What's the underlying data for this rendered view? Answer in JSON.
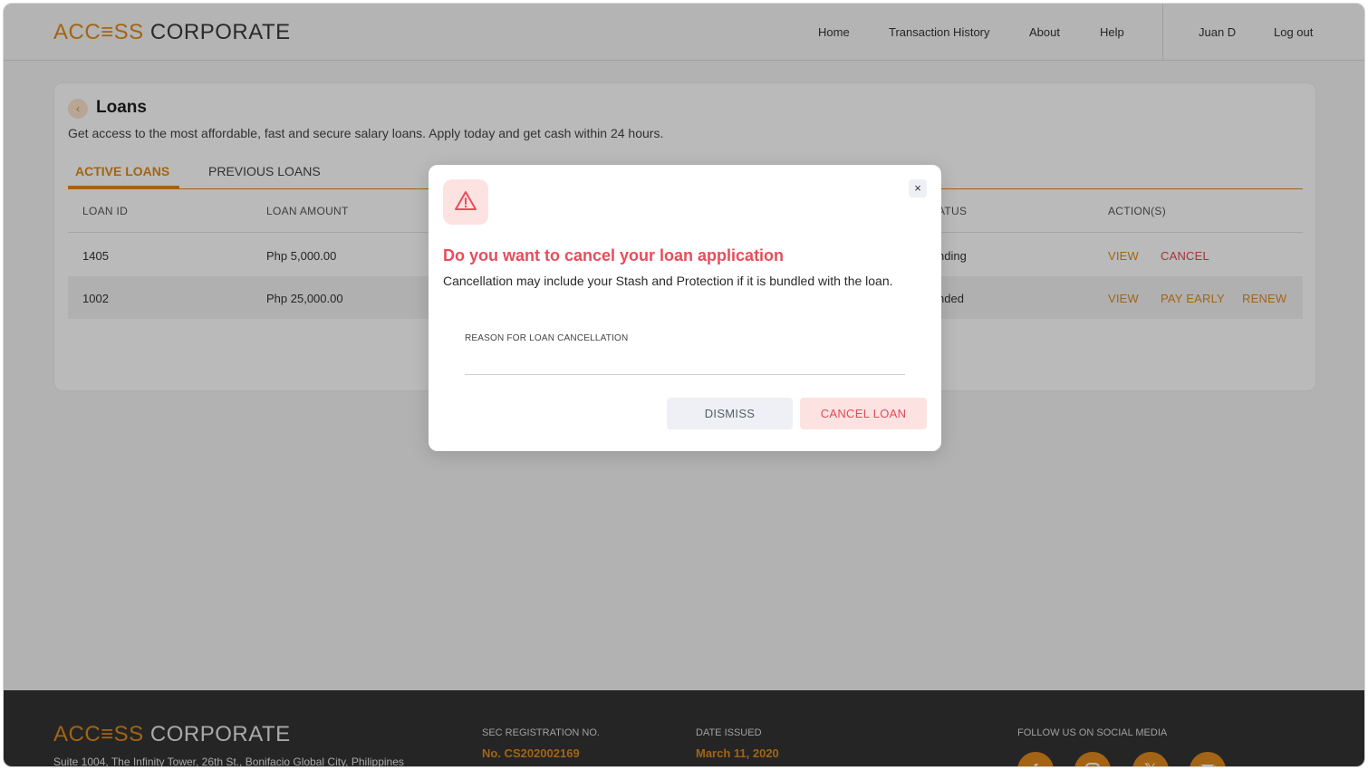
{
  "header": {
    "logo_part1": "ACC≡SS",
    "logo_part2": "CORPORATE",
    "nav": [
      "Home",
      "Transaction History",
      "About",
      "Help"
    ],
    "user": "Juan D",
    "logout": "Log out"
  },
  "loans": {
    "back_icon": "‹",
    "title": "Loans",
    "subtitle": "Get access to the most affordable, fast and secure salary loans. Apply today and get cash within 24 hours.",
    "tabs": [
      "ACTIVE LOANS",
      "PREVIOUS LOANS"
    ],
    "columns": [
      "LOAN ID",
      "LOAN AMOUNT",
      "ATUS",
      "ACTION(S)"
    ],
    "rows": [
      {
        "id": "1405",
        "amount": "Php 5,000.00",
        "status": "nding",
        "actions": [
          "VIEW",
          "CANCEL"
        ]
      },
      {
        "id": "1002",
        "amount": "Php 25,000.00",
        "status": "nded",
        "actions": [
          "VIEW",
          "PAY EARLY",
          "RENEW"
        ]
      }
    ]
  },
  "modal": {
    "icon": "warning-triangle-icon",
    "close": "×",
    "title": "Do you want to cancel your loan application",
    "text": "Cancellation may include your Stash and Protection if it is bundled with the loan.",
    "field_label": "REASON FOR LOAN CANCELLATION",
    "field_value": "",
    "dismiss": "DISMISS",
    "cancel": "CANCEL LOAN"
  },
  "footer": {
    "logo_part1": "ACC≡SS",
    "logo_part2": "CORPORATE",
    "address": "Suite 1004, The Infinity Tower, 26th St., Bonifacio Global City, Philippines",
    "sec_label": "SEC REGISTRATION NO.",
    "sec_value": "No. CS202002169",
    "date_label": "DATE ISSUED",
    "date_value": "March 11, 2020",
    "social_label": "FOLLOW US ON SOCIAL MEDIA",
    "social_icons": [
      "facebook-icon",
      "instagram-icon",
      "x-icon",
      "email-icon"
    ]
  },
  "colors": {
    "accent": "#e08a1e",
    "danger": "#ea4c5c",
    "footer_bg": "#333333"
  }
}
